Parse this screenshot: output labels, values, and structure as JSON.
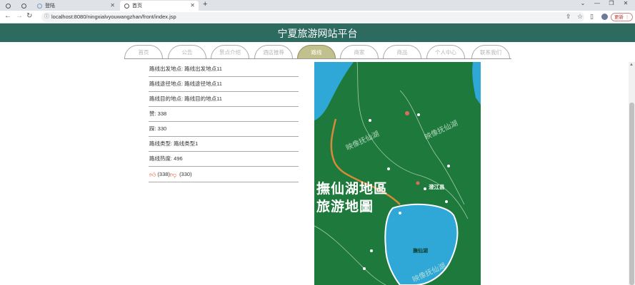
{
  "browser": {
    "tabs": [
      {
        "label": "",
        "active": false
      },
      {
        "label": "",
        "active": false
      },
      {
        "label": "登陆",
        "active": false
      },
      {
        "label": "首页",
        "active": true
      }
    ],
    "new_tab_label": "+",
    "url": "localhost:8080/ningxialvyouwangzhan/front/index.jsp",
    "update_label": "更新",
    "window_controls": [
      "⌄",
      "—",
      "❐",
      "✕"
    ]
  },
  "site": {
    "title": "宁夏旅游网站平台"
  },
  "nav": {
    "items": [
      "首页",
      "公告",
      "景点介绍",
      "酒店推荐",
      "路线",
      "商家",
      "商品",
      "个人中心",
      "联系我们"
    ],
    "active_index": 4
  },
  "detail": {
    "rows": [
      "路线出发地点: 路线出发地点11",
      "路线途径地点: 路线途径地点11",
      "路线目的地点: 路线目的地点11",
      "赞: 338",
      "踩: 330",
      "路线类型: 路线类型1",
      "路线热度: 496"
    ],
    "likes": "(338)",
    "dislikes": "(330)"
  },
  "map": {
    "title_line1": "撫仙湖地區",
    "title_line2": "旅游地圖",
    "watermark": "映像抚仙湖",
    "lake_label": "撫仙湖",
    "town_label": "澄江县",
    "colors": {
      "land": "#1e7a3c",
      "water": "#2fa8d8",
      "road": "#d88a3a",
      "label": "#ffffff",
      "accent": "#e06b5e"
    }
  }
}
